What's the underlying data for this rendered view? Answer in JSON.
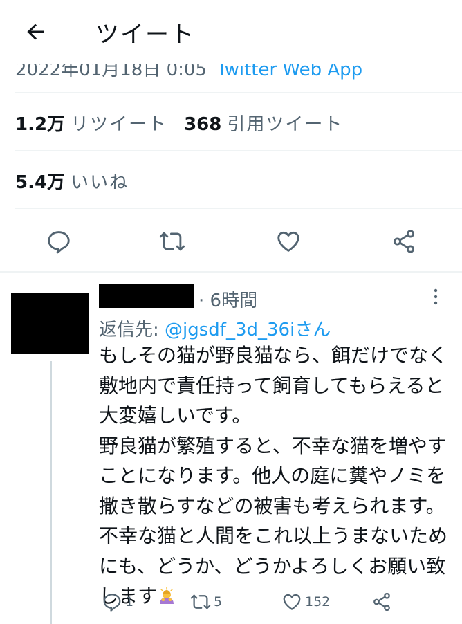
{
  "header": {
    "title": "ツイート"
  },
  "tweet": {
    "meta_clipped": "2022年01月18日 0:05",
    "source": "Twitter Web App",
    "stats": [
      {
        "num": "1.2万",
        "label": "リツイート"
      },
      {
        "num": "368",
        "label": "引用ツイート"
      }
    ],
    "likes": {
      "num": "5.4万",
      "label": "いいね"
    }
  },
  "action_icons": [
    "reply-icon",
    "retweet-icon",
    "like-icon",
    "share-icon"
  ],
  "reply": {
    "time": "· 6時間",
    "reply_prefix": "返信先: ",
    "reply_handle": "@jgsdf_3d_36iさん",
    "body_p1": "もしその猫が野良猫なら、餌だけでなく\n敷地内で責任持って飼育してもらえると\n大変嬉しいです。",
    "body_p2": "野良猫が繁殖すると、不幸な猫を増やす\nことになります。他人の庭に糞やノミを\n撒き散らすなどの被害も考えられます。\n不幸な猫と人間をこれ以上うまないため\nにも、どうか、どうかよろしくお願い致\nします",
    "emoji": "person-bowing-emoji",
    "counts": {
      "reply": "1",
      "retweet": "5",
      "like": "152"
    }
  },
  "colors": {
    "accent": "#1d9bf0",
    "muted": "#536471",
    "text": "#0f1419",
    "divider": "#eff3f4"
  }
}
